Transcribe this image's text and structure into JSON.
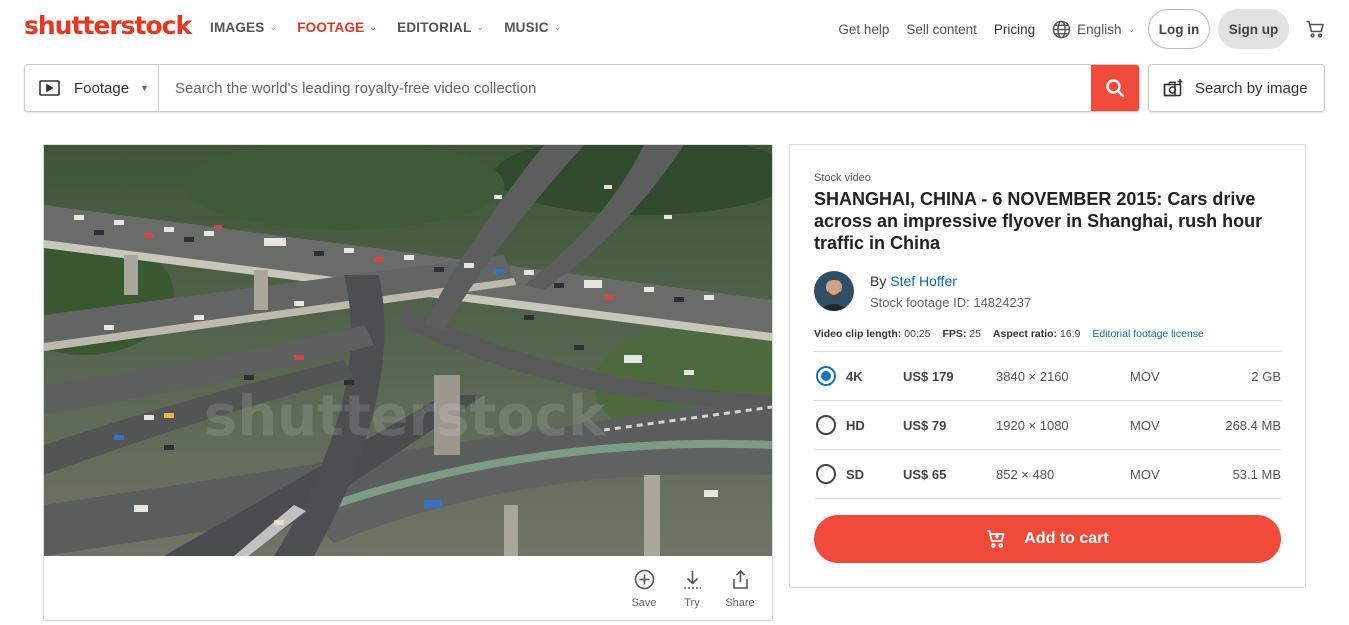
{
  "header": {
    "logo": "shutterstock",
    "nav": [
      {
        "label": "IMAGES",
        "active": false
      },
      {
        "label": "FOOTAGE",
        "active": true
      },
      {
        "label": "EDITORIAL",
        "active": false
      },
      {
        "label": "MUSIC",
        "active": false
      }
    ],
    "get_help": "Get help",
    "sell_content": "Sell content",
    "pricing": "Pricing",
    "language": "English",
    "login": "Log in",
    "signup": "Sign up"
  },
  "search": {
    "type_label": "Footage",
    "placeholder": "Search the world's leading royalty-free video collection",
    "search_by_image": "Search by image"
  },
  "video": {
    "watermark": "shutterstock",
    "actions": {
      "save": "Save",
      "try": "Try",
      "share": "Share"
    }
  },
  "detail": {
    "kicker": "Stock video",
    "title": "SHANGHAI, CHINA - 6 NOVEMBER 2015: Cars drive across an impressive flyover in Shanghai, rush hour traffic in China",
    "by_label": "By",
    "author": "Stef Hoffer",
    "footage_id": "Stock footage ID: 14824237",
    "meta": {
      "length_label": "Video clip length:",
      "length_value": "00:25",
      "fps_label": "FPS:",
      "fps_value": "25",
      "aspect_label": "Aspect ratio:",
      "aspect_value": "16:9",
      "license_link": "Editorial footage license"
    },
    "options": [
      {
        "quality": "4K",
        "price": "US$ 179",
        "resolution": "3840 × 2160",
        "format": "MOV",
        "size": "2 GB",
        "selected": true
      },
      {
        "quality": "HD",
        "price": "US$ 79",
        "resolution": "1920 × 1080",
        "format": "MOV",
        "size": "268.4 MB",
        "selected": false
      },
      {
        "quality": "SD",
        "price": "US$ 65",
        "resolution": "852 × 480",
        "format": "MOV",
        "size": "53.1 MB",
        "selected": false
      }
    ],
    "add_to_cart": "Add to cart"
  },
  "colors": {
    "brand": "#e8351f",
    "button": "#f04b3a",
    "link": "#0c6aa5",
    "radio": "#1a73b8"
  }
}
